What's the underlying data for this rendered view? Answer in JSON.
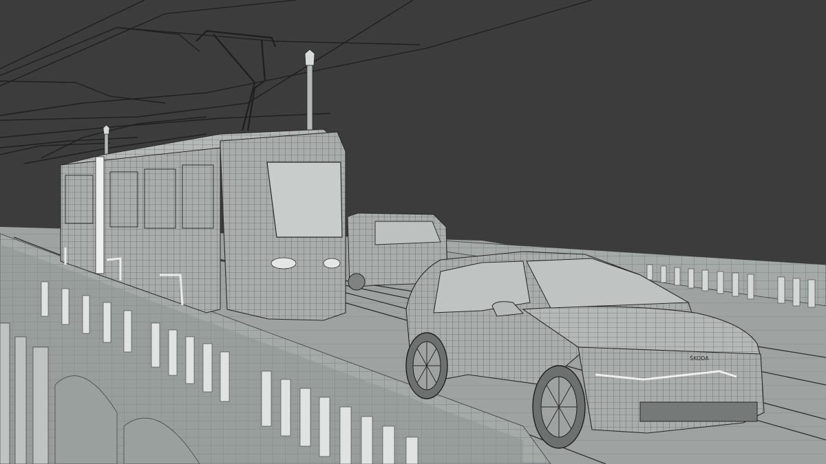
{
  "scene": {
    "kind": "3d-wireframe-render",
    "subjects": [
      "tram",
      "suv-car",
      "van",
      "bridge",
      "overhead-wires",
      "street-lamp"
    ],
    "colors": {
      "sky": "#3c3c3c",
      "mesh_fill": "#a9adab",
      "mesh_fill_light": "#c2c6c4",
      "mesh_fill_dark": "#8d918f",
      "wire": "#2a2a2a",
      "bridge_fill": "#a3aaa8",
      "road_fill": "#9ea3a1"
    }
  },
  "car": {
    "badge_text": "ŠKODA"
  }
}
